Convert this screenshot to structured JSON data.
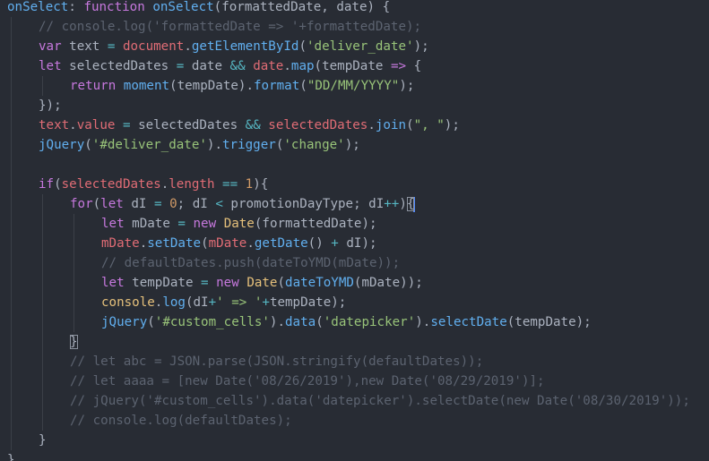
{
  "theme": {
    "background": "#282c34",
    "colors": {
      "plain": "#abb2bf",
      "keyword": "#c678dd",
      "function": "#61afef",
      "string": "#98c379",
      "variable": "#e06c75",
      "class": "#e5c07b",
      "number": "#d19a66",
      "operator": "#56b6c2",
      "comment": "#5c6370",
      "cursor": "#528bff"
    }
  },
  "code": {
    "lines": [
      {
        "indent": 0,
        "tokens": [
          {
            "t": "onSelect",
            "c": "function"
          },
          {
            "t": ": ",
            "c": "plain"
          },
          {
            "t": "function",
            "c": "keyword"
          },
          {
            "t": " ",
            "c": "plain"
          },
          {
            "t": "onSelect",
            "c": "function"
          },
          {
            "t": "(formattedDate, date) {",
            "c": "plain"
          }
        ]
      },
      {
        "indent": 1,
        "tokens": [
          {
            "t": "// console.log('formattedDate => '+formattedDate);",
            "c": "comment"
          }
        ]
      },
      {
        "indent": 1,
        "tokens": [
          {
            "t": "var",
            "c": "keyword"
          },
          {
            "t": " text ",
            "c": "plain"
          },
          {
            "t": "=",
            "c": "operator"
          },
          {
            "t": " ",
            "c": "plain"
          },
          {
            "t": "document",
            "c": "variable"
          },
          {
            "t": ".",
            "c": "plain"
          },
          {
            "t": "getElementById",
            "c": "function"
          },
          {
            "t": "(",
            "c": "plain"
          },
          {
            "t": "'deliver_date'",
            "c": "string"
          },
          {
            "t": ");",
            "c": "plain"
          }
        ]
      },
      {
        "indent": 1,
        "tokens": [
          {
            "t": "let",
            "c": "keyword"
          },
          {
            "t": " selectedDates ",
            "c": "plain"
          },
          {
            "t": "=",
            "c": "operator"
          },
          {
            "t": " date ",
            "c": "plain"
          },
          {
            "t": "&&",
            "c": "operator"
          },
          {
            "t": " ",
            "c": "plain"
          },
          {
            "t": "date",
            "c": "variable"
          },
          {
            "t": ".",
            "c": "plain"
          },
          {
            "t": "map",
            "c": "function"
          },
          {
            "t": "(tempDate ",
            "c": "plain"
          },
          {
            "t": "=>",
            "c": "keyword"
          },
          {
            "t": " {",
            "c": "plain"
          }
        ]
      },
      {
        "indent": 2,
        "tokens": [
          {
            "t": "return",
            "c": "keyword"
          },
          {
            "t": " ",
            "c": "plain"
          },
          {
            "t": "moment",
            "c": "function"
          },
          {
            "t": "(tempDate).",
            "c": "plain"
          },
          {
            "t": "format",
            "c": "function"
          },
          {
            "t": "(",
            "c": "plain"
          },
          {
            "t": "\"DD/MM/YYYY\"",
            "c": "string"
          },
          {
            "t": ");",
            "c": "plain"
          }
        ]
      },
      {
        "indent": 1,
        "tokens": [
          {
            "t": "});",
            "c": "plain"
          }
        ]
      },
      {
        "indent": 1,
        "tokens": [
          {
            "t": "text",
            "c": "variable"
          },
          {
            "t": ".",
            "c": "plain"
          },
          {
            "t": "value",
            "c": "variable"
          },
          {
            "t": " ",
            "c": "plain"
          },
          {
            "t": "=",
            "c": "operator"
          },
          {
            "t": " selectedDates ",
            "c": "plain"
          },
          {
            "t": "&&",
            "c": "operator"
          },
          {
            "t": " ",
            "c": "plain"
          },
          {
            "t": "selectedDates",
            "c": "variable"
          },
          {
            "t": ".",
            "c": "plain"
          },
          {
            "t": "join",
            "c": "function"
          },
          {
            "t": "(",
            "c": "plain"
          },
          {
            "t": "\", \"",
            "c": "string"
          },
          {
            "t": ");",
            "c": "plain"
          }
        ]
      },
      {
        "indent": 1,
        "tokens": [
          {
            "t": "jQuery",
            "c": "function"
          },
          {
            "t": "(",
            "c": "plain"
          },
          {
            "t": "'#deliver_date'",
            "c": "string"
          },
          {
            "t": ").",
            "c": "plain"
          },
          {
            "t": "trigger",
            "c": "function"
          },
          {
            "t": "(",
            "c": "plain"
          },
          {
            "t": "'change'",
            "c": "string"
          },
          {
            "t": ");",
            "c": "plain"
          }
        ]
      },
      {
        "indent": 0,
        "tokens": []
      },
      {
        "indent": 1,
        "tokens": [
          {
            "t": "if",
            "c": "keyword"
          },
          {
            "t": "(",
            "c": "plain"
          },
          {
            "t": "selectedDates",
            "c": "variable"
          },
          {
            "t": ".",
            "c": "plain"
          },
          {
            "t": "length",
            "c": "variable"
          },
          {
            "t": " ",
            "c": "plain"
          },
          {
            "t": "==",
            "c": "operator"
          },
          {
            "t": " ",
            "c": "plain"
          },
          {
            "t": "1",
            "c": "number"
          },
          {
            "t": "){",
            "c": "plain"
          }
        ]
      },
      {
        "indent": 2,
        "tokens": [
          {
            "t": "for",
            "c": "keyword"
          },
          {
            "t": "(",
            "c": "plain"
          },
          {
            "t": "let",
            "c": "keyword"
          },
          {
            "t": " dI ",
            "c": "plain"
          },
          {
            "t": "=",
            "c": "operator"
          },
          {
            "t": " ",
            "c": "plain"
          },
          {
            "t": "0",
            "c": "number"
          },
          {
            "t": "; dI ",
            "c": "plain"
          },
          {
            "t": "<",
            "c": "operator"
          },
          {
            "t": " promotionDayType; dI",
            "c": "plain"
          },
          {
            "t": "++",
            "c": "operator"
          },
          {
            "t": ")",
            "c": "plain"
          },
          {
            "t": "{",
            "c": "plain",
            "box": true,
            "cursor": true
          }
        ]
      },
      {
        "indent": 3,
        "tokens": [
          {
            "t": "let",
            "c": "keyword"
          },
          {
            "t": " mDate ",
            "c": "plain"
          },
          {
            "t": "=",
            "c": "operator"
          },
          {
            "t": " ",
            "c": "plain"
          },
          {
            "t": "new",
            "c": "keyword"
          },
          {
            "t": " ",
            "c": "plain"
          },
          {
            "t": "Date",
            "c": "class"
          },
          {
            "t": "(formattedDate);",
            "c": "plain"
          }
        ]
      },
      {
        "indent": 3,
        "tokens": [
          {
            "t": "mDate",
            "c": "variable"
          },
          {
            "t": ".",
            "c": "plain"
          },
          {
            "t": "setDate",
            "c": "function"
          },
          {
            "t": "(",
            "c": "plain"
          },
          {
            "t": "mDate",
            "c": "variable"
          },
          {
            "t": ".",
            "c": "plain"
          },
          {
            "t": "getDate",
            "c": "function"
          },
          {
            "t": "() ",
            "c": "plain"
          },
          {
            "t": "+",
            "c": "operator"
          },
          {
            "t": " dI);",
            "c": "plain"
          }
        ]
      },
      {
        "indent": 3,
        "tokens": [
          {
            "t": "// defaultDates.push(dateToYMD(mDate));",
            "c": "comment"
          }
        ]
      },
      {
        "indent": 3,
        "tokens": [
          {
            "t": "let",
            "c": "keyword"
          },
          {
            "t": " tempDate ",
            "c": "plain"
          },
          {
            "t": "=",
            "c": "operator"
          },
          {
            "t": " ",
            "c": "plain"
          },
          {
            "t": "new",
            "c": "keyword"
          },
          {
            "t": " ",
            "c": "plain"
          },
          {
            "t": "Date",
            "c": "class"
          },
          {
            "t": "(",
            "c": "plain"
          },
          {
            "t": "dateToYMD",
            "c": "function"
          },
          {
            "t": "(mDate));",
            "c": "plain"
          }
        ]
      },
      {
        "indent": 3,
        "tokens": [
          {
            "t": "console",
            "c": "class"
          },
          {
            "t": ".",
            "c": "plain"
          },
          {
            "t": "log",
            "c": "function"
          },
          {
            "t": "(dI",
            "c": "plain"
          },
          {
            "t": "+",
            "c": "operator"
          },
          {
            "t": "' => '",
            "c": "string"
          },
          {
            "t": "+",
            "c": "operator"
          },
          {
            "t": "tempDate);",
            "c": "plain"
          }
        ]
      },
      {
        "indent": 3,
        "tokens": [
          {
            "t": "jQuery",
            "c": "function"
          },
          {
            "t": "(",
            "c": "plain"
          },
          {
            "t": "'#custom_cells'",
            "c": "string"
          },
          {
            "t": ").",
            "c": "plain"
          },
          {
            "t": "data",
            "c": "function"
          },
          {
            "t": "(",
            "c": "plain"
          },
          {
            "t": "'datepicker'",
            "c": "string"
          },
          {
            "t": ").",
            "c": "plain"
          },
          {
            "t": "selectDate",
            "c": "function"
          },
          {
            "t": "(tempDate);",
            "c": "plain"
          }
        ]
      },
      {
        "indent": 2,
        "tokens": [
          {
            "t": "}",
            "c": "plain",
            "box": true
          }
        ]
      },
      {
        "indent": 2,
        "tokens": [
          {
            "t": "// let abc = JSON.parse(JSON.stringify(defaultDates));",
            "c": "comment"
          }
        ]
      },
      {
        "indent": 2,
        "tokens": [
          {
            "t": "// let aaaa = [new Date('08/26/2019'),new Date('08/29/2019')];",
            "c": "comment"
          }
        ]
      },
      {
        "indent": 2,
        "tokens": [
          {
            "t": "// jQuery('#custom_cells').data('datepicker').selectDate(new Date('08/30/2019'));",
            "c": "comment"
          }
        ]
      },
      {
        "indent": 2,
        "tokens": [
          {
            "t": "// console.log(defaultDates);",
            "c": "comment"
          }
        ]
      },
      {
        "indent": 1,
        "tokens": [
          {
            "t": "}",
            "c": "plain"
          }
        ]
      },
      {
        "indent": 0,
        "tokens": [
          {
            "t": "}",
            "c": "plain"
          }
        ]
      }
    ]
  }
}
